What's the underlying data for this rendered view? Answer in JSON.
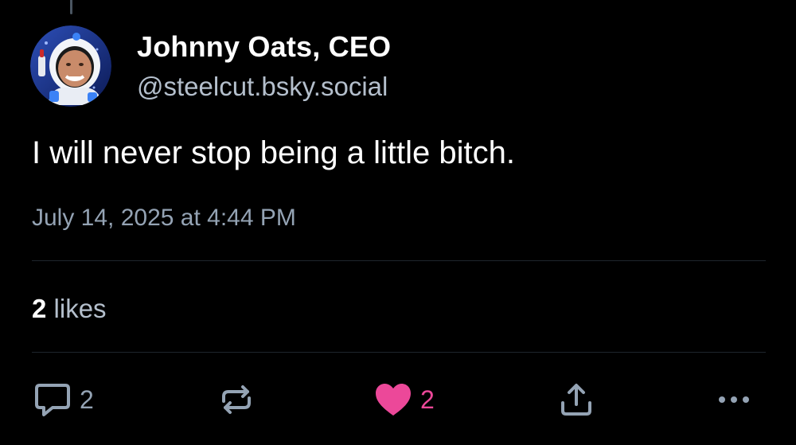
{
  "post": {
    "display_name": "Johnny Oats, CEO",
    "handle": "@steelcut.bsky.social",
    "text": "I will never stop being a little bitch.",
    "timestamp": "July 14, 2025 at 4:44 PM",
    "likes_count": "2",
    "likes_label": "likes"
  },
  "actions": {
    "reply_count": "2",
    "like_count": "2"
  },
  "colors": {
    "background": "#000000",
    "muted_text": "#94a3b4",
    "like_pink": "#ec4899",
    "divider": "#1e252d"
  },
  "icons": {
    "reply": "reply-bubble-icon",
    "repost": "repost-arrows-icon",
    "like": "heart-icon",
    "share": "share-upload-icon",
    "more": "more-dots-icon"
  }
}
